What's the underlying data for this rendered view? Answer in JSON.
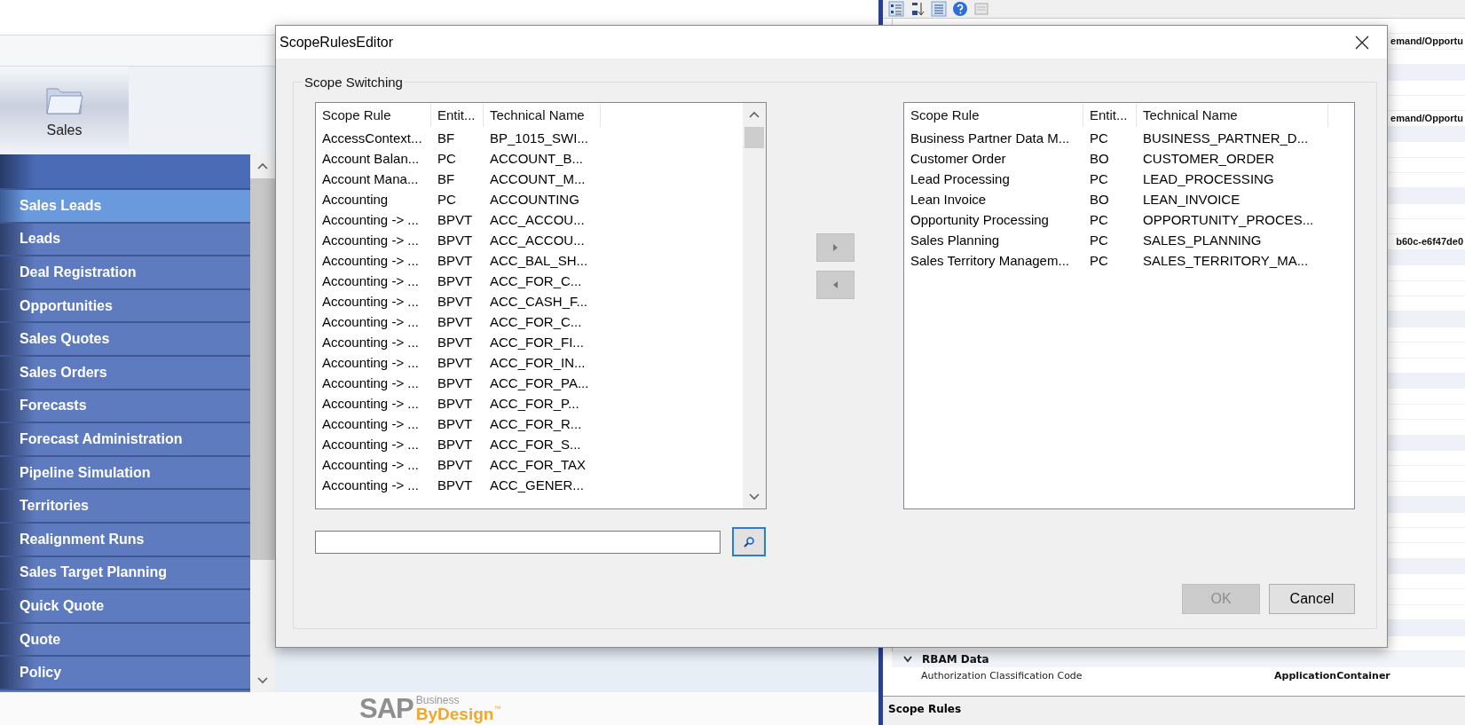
{
  "app": {
    "workcenter": {
      "label": "Sales"
    },
    "nav_items": [
      {
        "label": "Sales Leads",
        "selected": true
      },
      {
        "label": "Leads",
        "selected": false
      },
      {
        "label": "Deal Registration",
        "selected": false
      },
      {
        "label": "Opportunities",
        "selected": false
      },
      {
        "label": "Sales Quotes",
        "selected": false
      },
      {
        "label": "Sales Orders",
        "selected": false
      },
      {
        "label": "Forecasts",
        "selected": false
      },
      {
        "label": "Forecast Administration",
        "selected": false
      },
      {
        "label": "Pipeline Simulation",
        "selected": false
      },
      {
        "label": "Territories",
        "selected": false
      },
      {
        "label": "Realignment Runs",
        "selected": false
      },
      {
        "label": "Sales Target Planning",
        "selected": false
      },
      {
        "label": "Quick Quote",
        "selected": false
      },
      {
        "label": "Quote",
        "selected": false
      },
      {
        "label": "Policy",
        "selected": false
      }
    ],
    "logo": {
      "brand": "SAP",
      "line_1": "Business",
      "line_2": "ByDesign",
      "trademark": "™"
    }
  },
  "properties": {
    "visible_values": [
      {
        "value": "emand/Opportu"
      },
      {
        "value": "emand/Opportu"
      },
      {
        "value": "b60c-e6f47de0"
      }
    ],
    "groups": [
      {
        "title": "RBAM Data",
        "expanded": true,
        "rows": [
          {
            "name": "Authorization Classification Code",
            "value": "ApplicationContainer"
          }
        ]
      }
    ],
    "bottom_panel": {
      "title": "Scope Rules"
    }
  },
  "dialog": {
    "title": "ScopeRulesEditor",
    "group_label": "Scope Switching",
    "available": {
      "columns": [
        "Scope Rule",
        "Entit...",
        "Technical Name"
      ],
      "rows": [
        [
          "AccessContext...",
          "BF",
          "BP_1015_SWI..."
        ],
        [
          "Account Balan...",
          "PC",
          "ACCOUNT_B..."
        ],
        [
          "Account Mana...",
          "BF",
          "ACCOUNT_M..."
        ],
        [
          "Accounting",
          "PC",
          "ACCOUNTING"
        ],
        [
          "Accounting -> ...",
          "BPVT",
          "ACC_ACCOU..."
        ],
        [
          "Accounting -> ...",
          "BPVT",
          "ACC_ACCOU..."
        ],
        [
          "Accounting -> ...",
          "BPVT",
          "ACC_BAL_SH..."
        ],
        [
          "Accounting -> ...",
          "BPVT",
          "ACC_FOR_C..."
        ],
        [
          "Accounting -> ...",
          "BPVT",
          "ACC_CASH_F..."
        ],
        [
          "Accounting -> ...",
          "BPVT",
          "ACC_FOR_C..."
        ],
        [
          "Accounting -> ...",
          "BPVT",
          "ACC_FOR_FI..."
        ],
        [
          "Accounting -> ...",
          "BPVT",
          "ACC_FOR_IN..."
        ],
        [
          "Accounting -> ...",
          "BPVT",
          "ACC_FOR_PA..."
        ],
        [
          "Accounting -> ...",
          "BPVT",
          "ACC_FOR_P..."
        ],
        [
          "Accounting -> ...",
          "BPVT",
          "ACC_FOR_R..."
        ],
        [
          "Accounting -> ...",
          "BPVT",
          "ACC_FOR_S..."
        ],
        [
          "Accounting -> ...",
          "BPVT",
          "ACC_FOR_TAX"
        ],
        [
          "Accounting -> ...",
          "BPVT",
          "ACC_GENER..."
        ]
      ]
    },
    "assigned": {
      "columns": [
        "Scope Rule",
        "Entit...",
        "Technical Name"
      ],
      "rows": [
        [
          "Business Partner Data M...",
          "PC",
          "BUSINESS_PARTNER_D..."
        ],
        [
          "Customer Order",
          "BO",
          "CUSTOMER_ORDER"
        ],
        [
          "Lead Processing",
          "PC",
          "LEAD_PROCESSING"
        ],
        [
          "Lean Invoice",
          "BO",
          "LEAN_INVOICE"
        ],
        [
          "Opportunity Processing",
          "PC",
          "OPPORTUNITY_PROCES..."
        ],
        [
          "Sales Planning",
          "PC",
          "SALES_PLANNING"
        ],
        [
          "Sales Territory Managem...",
          "PC",
          "SALES_TERRITORY_MA..."
        ]
      ]
    },
    "move_buttons": [
      {
        "kind": "add",
        "disabled": true
      },
      {
        "kind": "remove",
        "disabled": true
      }
    ],
    "buttons": [
      {
        "label": "OK",
        "disabled": true
      },
      {
        "label": "Cancel",
        "disabled": false
      }
    ]
  }
}
